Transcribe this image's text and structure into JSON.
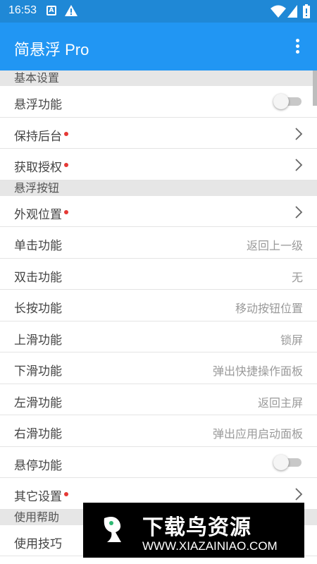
{
  "statusbar": {
    "time": "16:53",
    "a_badge": "A",
    "icons": [
      "a-icon",
      "warning-icon",
      "wifi-icon",
      "signal-icon",
      "battery-icon"
    ]
  },
  "appbar": {
    "title": "简悬浮 Pro",
    "menu_icon": "more-vert-icon"
  },
  "sections": {
    "basic": "基本设置",
    "button": "悬浮按钮",
    "help": "使用帮助"
  },
  "rows": {
    "float_function": "悬浮功能",
    "keep_background": "保持后台",
    "get_permission": "获取授权",
    "appearance": "外观位置",
    "single_click": {
      "label": "单击功能",
      "value": "返回上一级"
    },
    "double_click": {
      "label": "双击功能",
      "value": "无"
    },
    "long_press": {
      "label": "长按功能",
      "value": "移动按钮位置"
    },
    "swipe_up": {
      "label": "上滑功能",
      "value": "锁屏"
    },
    "swipe_down": {
      "label": "下滑功能",
      "value": "弹出快捷操作面板"
    },
    "swipe_left": {
      "label": "左滑功能",
      "value": "返回主屏"
    },
    "swipe_right": {
      "label": "右滑功能",
      "value": "弹出应用启动面板"
    },
    "hover": "悬停功能",
    "other_settings": "其它设置",
    "tips": "使用技巧"
  },
  "toggles": {
    "float_function": false,
    "hover": false
  },
  "colors": {
    "statusbar": "#1f88d6",
    "appbar": "#2196f3",
    "dot": "#e53935"
  },
  "watermark": {
    "name": "下载鸟资源",
    "url": "WWW.XIAZAINIAO.COM"
  }
}
